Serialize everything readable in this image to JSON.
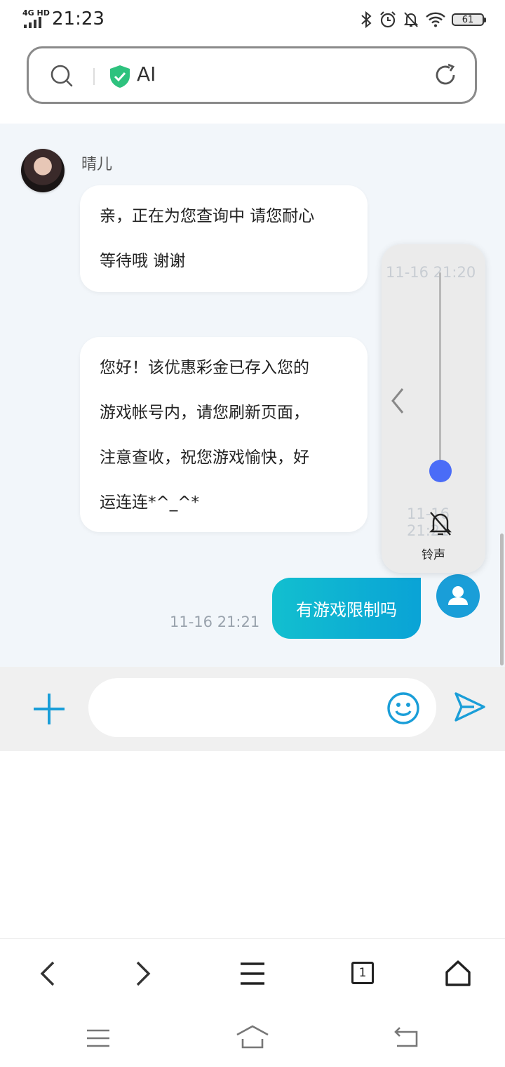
{
  "status_bar": {
    "network": "4G HD",
    "time": "21:23",
    "battery": "61"
  },
  "url_bar": {
    "text": "AI"
  },
  "chat": {
    "agent_name": "晴儿",
    "messages_in": [
      {
        "line1": "亲，正在为您查询中 请您耐心",
        "line2": "等待哦 谢谢"
      },
      {
        "line1": "您好！该优惠彩金已存入您的",
        "line2": "游戏帐号内，请您刷新页面，",
        "line3": "注意查收，祝您游戏愉快，好",
        "line4": "运连连*^_^*"
      }
    ],
    "message_out": "有游戏限制吗",
    "timestamp": "11-16 21:21"
  },
  "volume_panel": {
    "label": "铃声",
    "level": 0.03,
    "ghost_time_1": "11-16 21:20",
    "ghost_time_2": "11-16 21:21"
  },
  "input_bar": {
    "placeholder": ""
  },
  "toolbar": {
    "tabs_count": "1"
  },
  "colors": {
    "accent": "#1a9ed8",
    "slider_knob": "#4a6cf7",
    "shield": "#2ec27e",
    "chat_bg": "#f2f6fa"
  }
}
